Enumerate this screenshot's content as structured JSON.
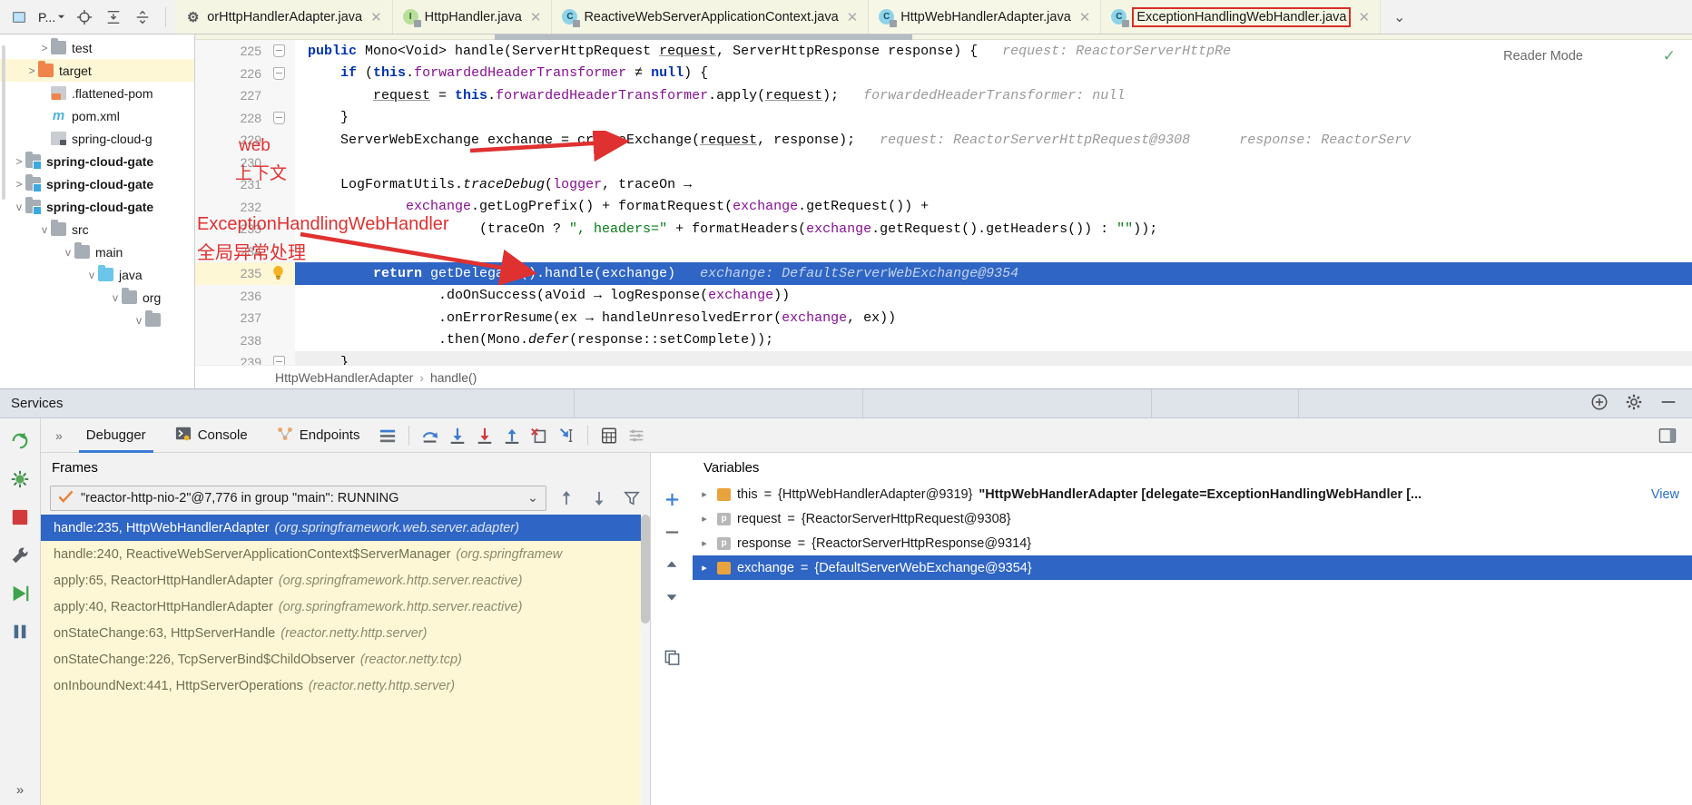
{
  "toolbar": {
    "project_label": "P...",
    "icons": [
      "project-icon",
      "locate-icon",
      "collapse-all-icon",
      "expand-all-icon"
    ]
  },
  "tabs": [
    {
      "label": "orHttpHandlerAdapter.java",
      "icon": "gear-icon",
      "active": false,
      "outlined": false
    },
    {
      "label": "HttpHandler.java",
      "icon": "interface-icon",
      "active": false,
      "outlined": false
    },
    {
      "label": "ReactiveWebServerApplicationContext.java",
      "icon": "class-icon",
      "active": false,
      "outlined": false
    },
    {
      "label": "HttpWebHandlerAdapter.java",
      "icon": "class-icon",
      "active": true,
      "outlined": false
    },
    {
      "label": "ExceptionHandlingWebHandler.java",
      "icon": "class-icon",
      "active": false,
      "outlined": true
    }
  ],
  "tree": [
    {
      "label": "test",
      "indent": 3,
      "twisty": ">",
      "icon": "folder-gray",
      "bold": false,
      "selected": false
    },
    {
      "label": "target",
      "indent": 2,
      "twisty": ">",
      "icon": "folder-orange",
      "bold": false,
      "selected": true
    },
    {
      "label": ".flattened-pom",
      "indent": 3,
      "twisty": "",
      "icon": "file-xml",
      "bold": false,
      "selected": false
    },
    {
      "label": "pom.xml",
      "indent": 3,
      "twisty": "",
      "icon": "file-maven",
      "bold": false,
      "selected": false
    },
    {
      "label": "spring-cloud-g",
      "indent": 3,
      "twisty": "",
      "icon": "file-generic",
      "bold": false,
      "selected": false
    },
    {
      "label": "spring-cloud-gate",
      "indent": 1,
      "twisty": ">",
      "icon": "folder-module",
      "bold": true,
      "selected": false
    },
    {
      "label": "spring-cloud-gate",
      "indent": 1,
      "twisty": ">",
      "icon": "folder-module",
      "bold": true,
      "selected": false
    },
    {
      "label": "spring-cloud-gate",
      "indent": 1,
      "twisty": "v",
      "icon": "folder-module",
      "bold": true,
      "selected": false
    },
    {
      "label": "src",
      "indent": 2,
      "twisty": "v",
      "icon": "folder-gray",
      "bold": false,
      "selected": false
    },
    {
      "label": "main",
      "indent": 3,
      "twisty": "v",
      "icon": "folder-gray",
      "bold": false,
      "selected": false
    },
    {
      "label": "java",
      "indent": 4,
      "twisty": "v",
      "icon": "folder-blue",
      "bold": false,
      "selected": false
    },
    {
      "label": "org",
      "indent": 5,
      "twisty": "v",
      "icon": "folder-gray",
      "bold": false,
      "selected": false
    },
    {
      "label": "",
      "indent": 6,
      "twisty": "v",
      "icon": "folder-gray",
      "bold": false,
      "selected": false
    }
  ],
  "editor": {
    "reader_mode_label": "Reader Mode",
    "breadcrumb": {
      "class": "HttpWebHandlerAdapter",
      "separator": "›",
      "method": "handle()"
    },
    "lines": [
      {
        "num": "225",
        "fold": true,
        "marker": "breakpoint-modified",
        "highlighted": false
      },
      {
        "num": "226",
        "fold": true,
        "marker": "",
        "highlighted": false
      },
      {
        "num": "227",
        "fold": false,
        "marker": "",
        "highlighted": false
      },
      {
        "num": "228",
        "fold": true,
        "marker": "",
        "highlighted": false
      },
      {
        "num": "229",
        "fold": false,
        "marker": "",
        "highlighted": false
      },
      {
        "num": "230",
        "fold": false,
        "marker": "",
        "highlighted": false
      },
      {
        "num": "231",
        "fold": false,
        "marker": "",
        "highlighted": false
      },
      {
        "num": "232",
        "fold": false,
        "marker": "",
        "highlighted": false
      },
      {
        "num": "233",
        "fold": false,
        "marker": "",
        "highlighted": false
      },
      {
        "num": "234",
        "fold": false,
        "marker": "",
        "highlighted": false
      },
      {
        "num": "235",
        "fold": false,
        "marker": "breakpoint-checked",
        "highlighted": true
      },
      {
        "num": "236",
        "fold": false,
        "marker": "",
        "highlighted": false
      },
      {
        "num": "237",
        "fold": false,
        "marker": "",
        "highlighted": false
      },
      {
        "num": "238",
        "fold": false,
        "marker": "",
        "highlighted": false
      },
      {
        "num": "239",
        "fold": true,
        "marker": "",
        "highlighted": false
      }
    ],
    "inline_hints": {
      "line225": "request: ReactorServerHttpRe",
      "line225b": "",
      "line227": "forwardedHeaderTransformer: null",
      "line229a": "request: ReactorServerHttpRequest@9308",
      "line229b": "response: ReactorServ",
      "line235": "exchange: DefaultServerWebExchange@9354"
    }
  },
  "annotations": [
    {
      "text": "web",
      "kind": "latin"
    },
    {
      "text": "上下文",
      "kind": "cjk"
    },
    {
      "text": "ExceptionHandlingWebHandler",
      "kind": "latin"
    },
    {
      "text": "全局异常处理",
      "kind": "cjk"
    }
  ],
  "services": {
    "title": "Services",
    "header_actions": [
      "add-service-icon",
      "settings-gear-icon",
      "minimize-icon"
    ],
    "tabs": [
      {
        "label": "Debugger",
        "icon": "",
        "active": true
      },
      {
        "label": "Console",
        "icon": "console-icon",
        "active": false
      },
      {
        "label": "Endpoints",
        "icon": "endpoints-icon",
        "active": false
      }
    ],
    "toolbar_icons": [
      "layout-icon",
      "step-over-icon",
      "step-into-icon",
      "force-step-into-icon",
      "step-out-icon",
      "drop-frame-icon",
      "run-to-cursor-icon",
      "evaluate-expression-icon",
      "settings-list-icon"
    ],
    "rail_icons": [
      "rerun-icon",
      "bug-settings-icon",
      "stop-icon",
      "wrench-icon",
      "resume-icon",
      "pause-icon",
      "expand-icon"
    ],
    "frames": {
      "title": "Frames",
      "thread": "\"reactor-http-nio-2\"@7,776 in group \"main\": RUNNING",
      "thread_status_icon": "check-icon",
      "buttons": [
        "frame-up-icon",
        "frame-down-icon",
        "filter-icon"
      ],
      "items": [
        {
          "name": "handle:235, HttpWebHandlerAdapter",
          "pkg": "(org.springframework.web.server.adapter)",
          "selected": true
        },
        {
          "name": "handle:240, ReactiveWebServerApplicationContext$ServerManager",
          "pkg": "(org.springframew",
          "selected": false
        },
        {
          "name": "apply:65, ReactorHttpHandlerAdapter",
          "pkg": "(org.springframework.http.server.reactive)",
          "selected": false
        },
        {
          "name": "apply:40, ReactorHttpHandlerAdapter",
          "pkg": "(org.springframework.http.server.reactive)",
          "selected": false
        },
        {
          "name": "onStateChange:63, HttpServerHandle",
          "pkg": "(reactor.netty.http.server)",
          "selected": false
        },
        {
          "name": "onStateChange:226, TcpServerBind$ChildObserver",
          "pkg": "(reactor.netty.tcp)",
          "selected": false
        },
        {
          "name": "onInboundNext:441, HttpServerOperations",
          "pkg": "(reactor.netty.http.server)",
          "selected": false
        }
      ]
    },
    "variables": {
      "title": "Variables",
      "toolbar_icons": [
        "add-watch-icon",
        "remove-watch-icon",
        "collapse-icon",
        "copy-icon"
      ],
      "items": [
        {
          "arrow": "▸",
          "icon": "object-icon",
          "name": "this",
          "eq": " = ",
          "value": "{HttpWebHandlerAdapter@9319}",
          "detail": "\"HttpWebHandlerAdapter [delegate=ExceptionHandlingWebHandler [...",
          "action": "View",
          "selected": false
        },
        {
          "arrow": "▸",
          "icon": "param-icon",
          "name": "request",
          "eq": " = ",
          "value": "{ReactorServerHttpRequest@9308}",
          "detail": "",
          "action": "",
          "selected": false
        },
        {
          "arrow": "▸",
          "icon": "param-icon",
          "name": "response",
          "eq": " = ",
          "value": "{ReactorServerHttpResponse@9314}",
          "detail": "",
          "action": "",
          "selected": false
        },
        {
          "arrow": "▸",
          "icon": "object-icon",
          "name": "exchange",
          "eq": " = ",
          "value": "{DefaultServerWebExchange@9354}",
          "detail": "",
          "action": "",
          "selected": true
        }
      ]
    }
  },
  "colors": {
    "selection_blue": "#2f65c4",
    "annotation_red": "#e03131",
    "tab_active_bg": "#f5f5e4",
    "keyword_blue": "#0033b3",
    "field_purple": "#871094",
    "string_green": "#067d17",
    "hint_gray": "#9a9a9a"
  }
}
